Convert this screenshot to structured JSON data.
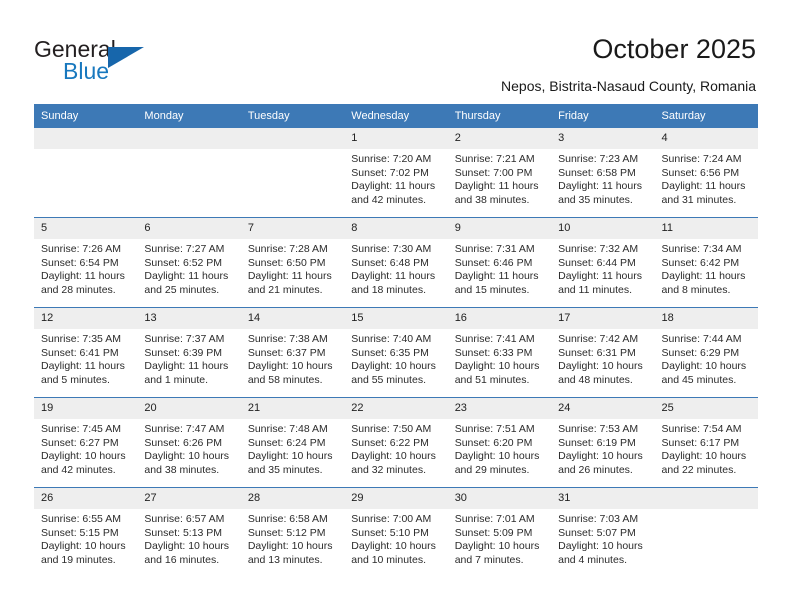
{
  "brand": {
    "line1": "General",
    "line2": "Blue",
    "logo_icon": "triangle-icon",
    "accent_color": "#1766ab"
  },
  "header": {
    "title": "October 2025",
    "subtitle": "Nepos, Bistrita-Nasaud County, Romania",
    "header_bg": "#3d79b6",
    "daynum_bg": "#eeeeee"
  },
  "weekdays": [
    "Sunday",
    "Monday",
    "Tuesday",
    "Wednesday",
    "Thursday",
    "Friday",
    "Saturday"
  ],
  "weeks": [
    [
      {
        "day": "",
        "empty": true
      },
      {
        "day": "",
        "empty": true
      },
      {
        "day": "",
        "empty": true
      },
      {
        "day": "1",
        "sunrise": "Sunrise: 7:20 AM",
        "sunset": "Sunset: 7:02 PM",
        "daylight1": "Daylight: 11 hours",
        "daylight2": "and 42 minutes."
      },
      {
        "day": "2",
        "sunrise": "Sunrise: 7:21 AM",
        "sunset": "Sunset: 7:00 PM",
        "daylight1": "Daylight: 11 hours",
        "daylight2": "and 38 minutes."
      },
      {
        "day": "3",
        "sunrise": "Sunrise: 7:23 AM",
        "sunset": "Sunset: 6:58 PM",
        "daylight1": "Daylight: 11 hours",
        "daylight2": "and 35 minutes."
      },
      {
        "day": "4",
        "sunrise": "Sunrise: 7:24 AM",
        "sunset": "Sunset: 6:56 PM",
        "daylight1": "Daylight: 11 hours",
        "daylight2": "and 31 minutes."
      }
    ],
    [
      {
        "day": "5",
        "sunrise": "Sunrise: 7:26 AM",
        "sunset": "Sunset: 6:54 PM",
        "daylight1": "Daylight: 11 hours",
        "daylight2": "and 28 minutes."
      },
      {
        "day": "6",
        "sunrise": "Sunrise: 7:27 AM",
        "sunset": "Sunset: 6:52 PM",
        "daylight1": "Daylight: 11 hours",
        "daylight2": "and 25 minutes."
      },
      {
        "day": "7",
        "sunrise": "Sunrise: 7:28 AM",
        "sunset": "Sunset: 6:50 PM",
        "daylight1": "Daylight: 11 hours",
        "daylight2": "and 21 minutes."
      },
      {
        "day": "8",
        "sunrise": "Sunrise: 7:30 AM",
        "sunset": "Sunset: 6:48 PM",
        "daylight1": "Daylight: 11 hours",
        "daylight2": "and 18 minutes."
      },
      {
        "day": "9",
        "sunrise": "Sunrise: 7:31 AM",
        "sunset": "Sunset: 6:46 PM",
        "daylight1": "Daylight: 11 hours",
        "daylight2": "and 15 minutes."
      },
      {
        "day": "10",
        "sunrise": "Sunrise: 7:32 AM",
        "sunset": "Sunset: 6:44 PM",
        "daylight1": "Daylight: 11 hours",
        "daylight2": "and 11 minutes."
      },
      {
        "day": "11",
        "sunrise": "Sunrise: 7:34 AM",
        "sunset": "Sunset: 6:42 PM",
        "daylight1": "Daylight: 11 hours",
        "daylight2": "and 8 minutes."
      }
    ],
    [
      {
        "day": "12",
        "sunrise": "Sunrise: 7:35 AM",
        "sunset": "Sunset: 6:41 PM",
        "daylight1": "Daylight: 11 hours",
        "daylight2": "and 5 minutes."
      },
      {
        "day": "13",
        "sunrise": "Sunrise: 7:37 AM",
        "sunset": "Sunset: 6:39 PM",
        "daylight1": "Daylight: 11 hours",
        "daylight2": "and 1 minute."
      },
      {
        "day": "14",
        "sunrise": "Sunrise: 7:38 AM",
        "sunset": "Sunset: 6:37 PM",
        "daylight1": "Daylight: 10 hours",
        "daylight2": "and 58 minutes."
      },
      {
        "day": "15",
        "sunrise": "Sunrise: 7:40 AM",
        "sunset": "Sunset: 6:35 PM",
        "daylight1": "Daylight: 10 hours",
        "daylight2": "and 55 minutes."
      },
      {
        "day": "16",
        "sunrise": "Sunrise: 7:41 AM",
        "sunset": "Sunset: 6:33 PM",
        "daylight1": "Daylight: 10 hours",
        "daylight2": "and 51 minutes."
      },
      {
        "day": "17",
        "sunrise": "Sunrise: 7:42 AM",
        "sunset": "Sunset: 6:31 PM",
        "daylight1": "Daylight: 10 hours",
        "daylight2": "and 48 minutes."
      },
      {
        "day": "18",
        "sunrise": "Sunrise: 7:44 AM",
        "sunset": "Sunset: 6:29 PM",
        "daylight1": "Daylight: 10 hours",
        "daylight2": "and 45 minutes."
      }
    ],
    [
      {
        "day": "19",
        "sunrise": "Sunrise: 7:45 AM",
        "sunset": "Sunset: 6:27 PM",
        "daylight1": "Daylight: 10 hours",
        "daylight2": "and 42 minutes."
      },
      {
        "day": "20",
        "sunrise": "Sunrise: 7:47 AM",
        "sunset": "Sunset: 6:26 PM",
        "daylight1": "Daylight: 10 hours",
        "daylight2": "and 38 minutes."
      },
      {
        "day": "21",
        "sunrise": "Sunrise: 7:48 AM",
        "sunset": "Sunset: 6:24 PM",
        "daylight1": "Daylight: 10 hours",
        "daylight2": "and 35 minutes."
      },
      {
        "day": "22",
        "sunrise": "Sunrise: 7:50 AM",
        "sunset": "Sunset: 6:22 PM",
        "daylight1": "Daylight: 10 hours",
        "daylight2": "and 32 minutes."
      },
      {
        "day": "23",
        "sunrise": "Sunrise: 7:51 AM",
        "sunset": "Sunset: 6:20 PM",
        "daylight1": "Daylight: 10 hours",
        "daylight2": "and 29 minutes."
      },
      {
        "day": "24",
        "sunrise": "Sunrise: 7:53 AM",
        "sunset": "Sunset: 6:19 PM",
        "daylight1": "Daylight: 10 hours",
        "daylight2": "and 26 minutes."
      },
      {
        "day": "25",
        "sunrise": "Sunrise: 7:54 AM",
        "sunset": "Sunset: 6:17 PM",
        "daylight1": "Daylight: 10 hours",
        "daylight2": "and 22 minutes."
      }
    ],
    [
      {
        "day": "26",
        "sunrise": "Sunrise: 6:55 AM",
        "sunset": "Sunset: 5:15 PM",
        "daylight1": "Daylight: 10 hours",
        "daylight2": "and 19 minutes."
      },
      {
        "day": "27",
        "sunrise": "Sunrise: 6:57 AM",
        "sunset": "Sunset: 5:13 PM",
        "daylight1": "Daylight: 10 hours",
        "daylight2": "and 16 minutes."
      },
      {
        "day": "28",
        "sunrise": "Sunrise: 6:58 AM",
        "sunset": "Sunset: 5:12 PM",
        "daylight1": "Daylight: 10 hours",
        "daylight2": "and 13 minutes."
      },
      {
        "day": "29",
        "sunrise": "Sunrise: 7:00 AM",
        "sunset": "Sunset: 5:10 PM",
        "daylight1": "Daylight: 10 hours",
        "daylight2": "and 10 minutes."
      },
      {
        "day": "30",
        "sunrise": "Sunrise: 7:01 AM",
        "sunset": "Sunset: 5:09 PM",
        "daylight1": "Daylight: 10 hours",
        "daylight2": "and 7 minutes."
      },
      {
        "day": "31",
        "sunrise": "Sunrise: 7:03 AM",
        "sunset": "Sunset: 5:07 PM",
        "daylight1": "Daylight: 10 hours",
        "daylight2": "and 4 minutes."
      },
      {
        "day": "",
        "empty": true
      }
    ]
  ]
}
